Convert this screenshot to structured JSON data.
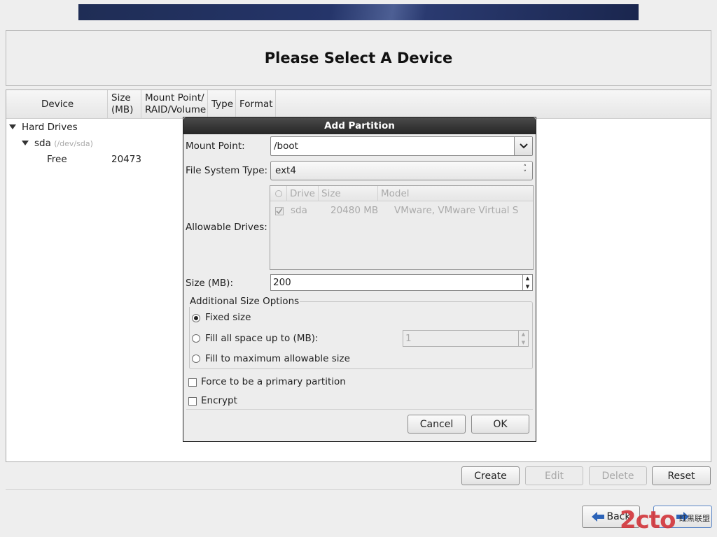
{
  "page": {
    "title": "Please Select A Device"
  },
  "device_tree": {
    "columns": [
      "Device",
      "Size\n(MB)",
      "Mount Point/\nRAID/Volume",
      "Type",
      "Format"
    ],
    "col_device": "Device",
    "col_size_l1": "Size",
    "col_size_l2": "(MB)",
    "col_mount_l1": "Mount Point/",
    "col_mount_l2": "RAID/Volume",
    "col_type": "Type",
    "col_format": "Format",
    "group_label": "Hard Drives",
    "disk_name": "sda",
    "disk_path": "(/dev/sda)",
    "free_label": "Free",
    "free_size": "20473"
  },
  "actions": {
    "create": "Create",
    "edit": "Edit",
    "delete": "Delete",
    "reset": "Reset"
  },
  "nav": {
    "back": "Back"
  },
  "dialog": {
    "title": "Add Partition",
    "mount_point_label": "Mount Point:",
    "mount_point_value": "/boot",
    "fs_type_label": "File System Type:",
    "fs_type_value": "ext4",
    "allowable_drives_label": "Allowable Drives:",
    "drives_columns": {
      "drive": "Drive",
      "size": "Size",
      "model": "Model"
    },
    "drives": [
      {
        "checked": true,
        "drive": "sda",
        "size": "20480 MB",
        "model": "VMware, VMware Virtual S"
      }
    ],
    "size_label": "Size (MB):",
    "size_value": "200",
    "additional_options_label": "Additional Size Options",
    "fixed_size_label": "Fixed size",
    "fill_up_to_label": "Fill all space up to (MB):",
    "fill_up_to_value": "1",
    "fill_max_label": "Fill to maximum allowable size",
    "selected_size_option": "Fixed size",
    "force_primary_label": "Force to be a primary partition",
    "force_primary_checked": false,
    "encrypt_label": "Encrypt",
    "encrypt_checked": false,
    "cancel_label": "Cancel",
    "ok_label": "OK"
  },
  "watermark": {
    "logo_text": "2cto",
    "sub_text": "红黑联盟"
  }
}
